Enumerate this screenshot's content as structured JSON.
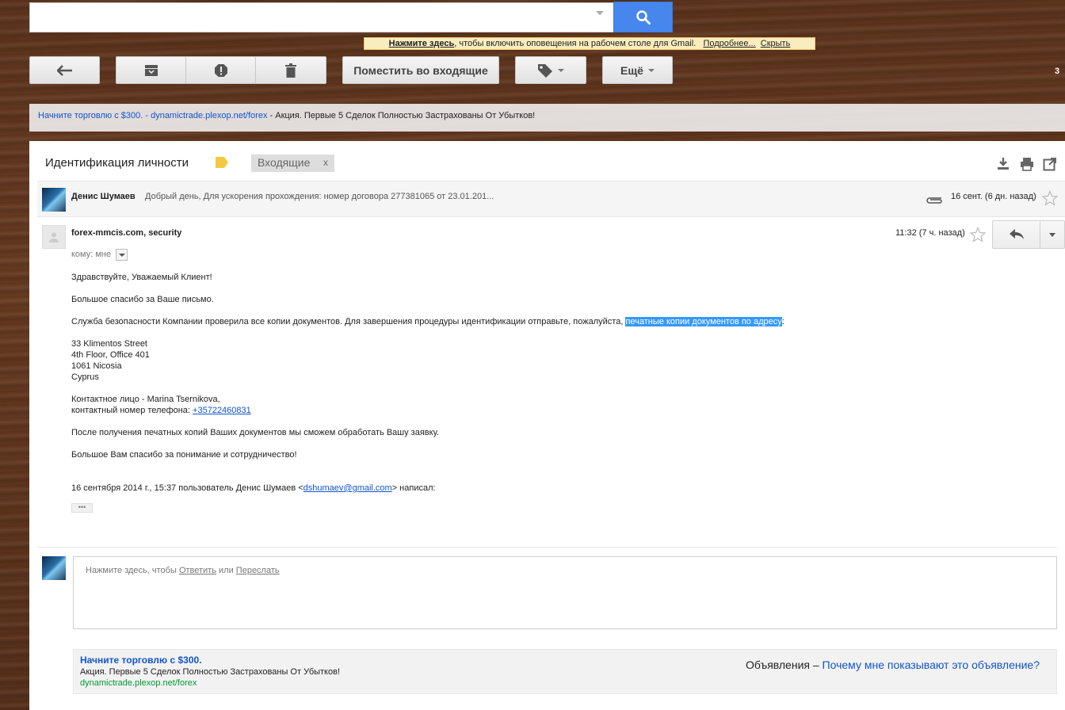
{
  "search": {
    "placeholder": ""
  },
  "notification": {
    "enable_link": "Нажмите здесь",
    "text": ", чтобы включить оповещения на рабочем столе для Gmail.",
    "more_link": "Подробнее...",
    "hide_link": "Скрыть"
  },
  "toolbar": {
    "move_inbox_label": "Поместить во входящие",
    "more_label": "Ещё",
    "page_count": "3"
  },
  "top_ad": {
    "headline": "Начните торговлю с $300.",
    "sep": " - ",
    "url": "dynamictrade.plexop.net/forex",
    "text": " - Акция. Первые 5 Сделок Полностью Застрахованы От Убытков!"
  },
  "thread": {
    "subject": "Идентификация личности",
    "label": "Входящие",
    "label_close": "x"
  },
  "collapsed_message": {
    "sender": "Денис Шумаев",
    "snippet": "Добрый день, Для ускорения прохождения: номер договора 277381065 от 23.01.201...",
    "date": "16 сент. (6 дн. назад)"
  },
  "message": {
    "sender": "forex-mmcis.com, security",
    "to": "кому: мне",
    "time": "11:32 (7 ч. назад)",
    "greeting": "Здравствуйте, Уважаемый Клиент!",
    "thanks": "Большое спасибо за Ваше письмо.",
    "security_pre": "Служба безопасности Компании проверила все копии документов. Для завершения процедуры идентификации отправьте, пожалуйста, ",
    "security_highlight": "печатные копии документов по адресу",
    "security_post": ":",
    "address": [
      "33 Klimentos Street",
      "4th Floor, Office 401",
      "1061 Nicosia",
      "Cyprus"
    ],
    "contact_person": "Контактное лицо - Marina Tsernikova,",
    "contact_phone_label": "контактный номер телефона: ",
    "contact_phone": "+35722460831",
    "after": "После получения печатных копий Ваших документов мы сможем обработать Вашу заявку.",
    "closing": "Большое Вам спасибо за понимание и сотрудничество!",
    "quote_pre": "16 сентября 2014 г., 15:37 пользователь Денис Шумаев <",
    "quote_email": "dshumaev@gmail.com",
    "quote_post": "> написал:",
    "ellipsis": "•••"
  },
  "reply": {
    "hint_pre": "Нажмите здесь, чтобы ",
    "reply_link": "Ответить",
    "or": " или ",
    "forward_link": "Переслать"
  },
  "bottom_ad": {
    "headline": "Начните торговлю с $300.",
    "text": "Акция. Первые 5 Сделок Полностью Застрахованы От Убытков!",
    "url": "dynamictrade.plexop.net/forex",
    "ads_label": "Объявления – ",
    "why_link": "Почему мне показывают это объявление?"
  },
  "colors": {
    "accent": "#4787ed",
    "link": "#1155cc",
    "ad_url": "#009933",
    "highlight": "#3399ff"
  }
}
